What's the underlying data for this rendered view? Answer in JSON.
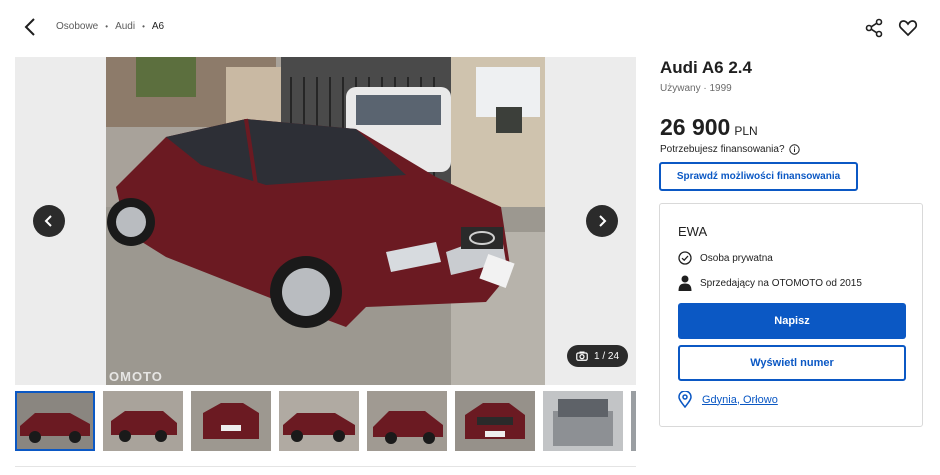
{
  "breadcrumb": {
    "items": [
      "Osobowe",
      "Audi",
      "A6"
    ]
  },
  "icons": {
    "back": "chevron-left-icon",
    "share": "share-icon",
    "favorite": "heart-icon",
    "gallery_prev": "chevron-left-icon",
    "gallery_next": "chevron-right-icon",
    "camera": "camera-icon",
    "info": "info-icon",
    "verified": "check-circle-icon",
    "person": "person-icon",
    "location": "location-pin-icon"
  },
  "gallery": {
    "counter": "1 / 24",
    "watermark": "OMOTO",
    "car_color": "#6b1a22"
  },
  "listing": {
    "title": "Audi A6 2.4",
    "subtitle": "Używany · 1999",
    "price": "26 900",
    "currency": "PLN",
    "financing_question": "Potrzebujesz finansowania?",
    "financing_button": "Sprawdź możliwości finansowania"
  },
  "seller": {
    "name": "EWA",
    "type": "Osoba prywatna",
    "since": "Sprzedający na OTOMOTO od 2015",
    "write_button": "Napisz",
    "phone_button": "Wyświetl numer",
    "location": "Gdynia, Orłowo"
  },
  "colors": {
    "accent": "#0b58c4",
    "text": "#1f1f1f",
    "muted": "#6b6b6b"
  }
}
